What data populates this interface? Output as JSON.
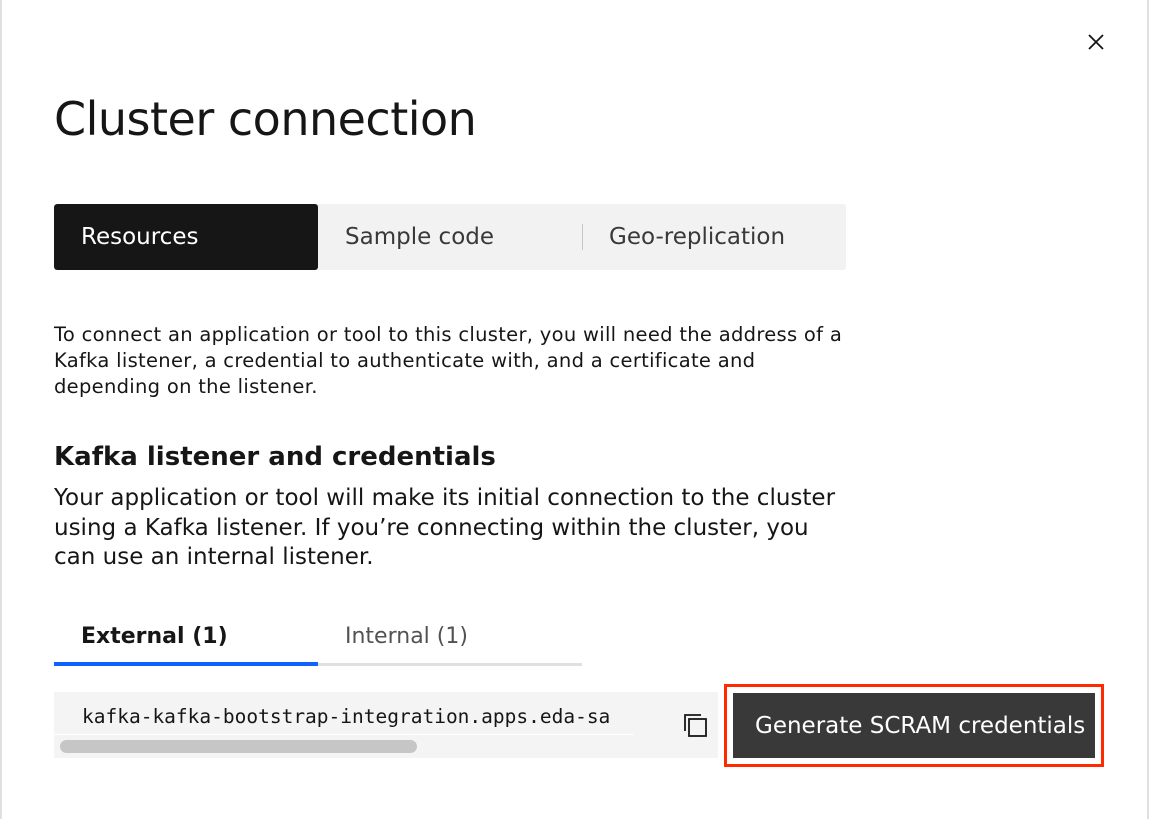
{
  "modal": {
    "title": "Cluster connection",
    "close_icon": "close-icon"
  },
  "switcher": {
    "items": [
      {
        "label": "Resources",
        "selected": true
      },
      {
        "label": "Sample code",
        "selected": false
      },
      {
        "label": "Geo-replication",
        "selected": false
      }
    ]
  },
  "intro": {
    "text": "To connect an application or tool to this cluster, you will need the address of a Kafka listener, a credential to authenticate with, and a certificate and depending on the listener."
  },
  "section": {
    "heading": "Kafka listener and credentials",
    "body": "Your application or tool will make its initial connection to the cluster using a Kafka listener. If you’re connecting within the cluster, you can use an internal listener."
  },
  "tabs": {
    "items": [
      {
        "label": "External (1)",
        "selected": true
      },
      {
        "label": "Internal (1)",
        "selected": false
      }
    ]
  },
  "listener": {
    "address": "kafka-kafka-bootstrap-integration.apps.eda-sa",
    "copy_icon": "copy-icon"
  },
  "actions": {
    "generate_label": "Generate SCRAM credentials"
  },
  "colors": {
    "accent": "#0f62fe",
    "highlight": "#ff2a00",
    "active_bg": "#161616",
    "button_bg": "#393939"
  }
}
